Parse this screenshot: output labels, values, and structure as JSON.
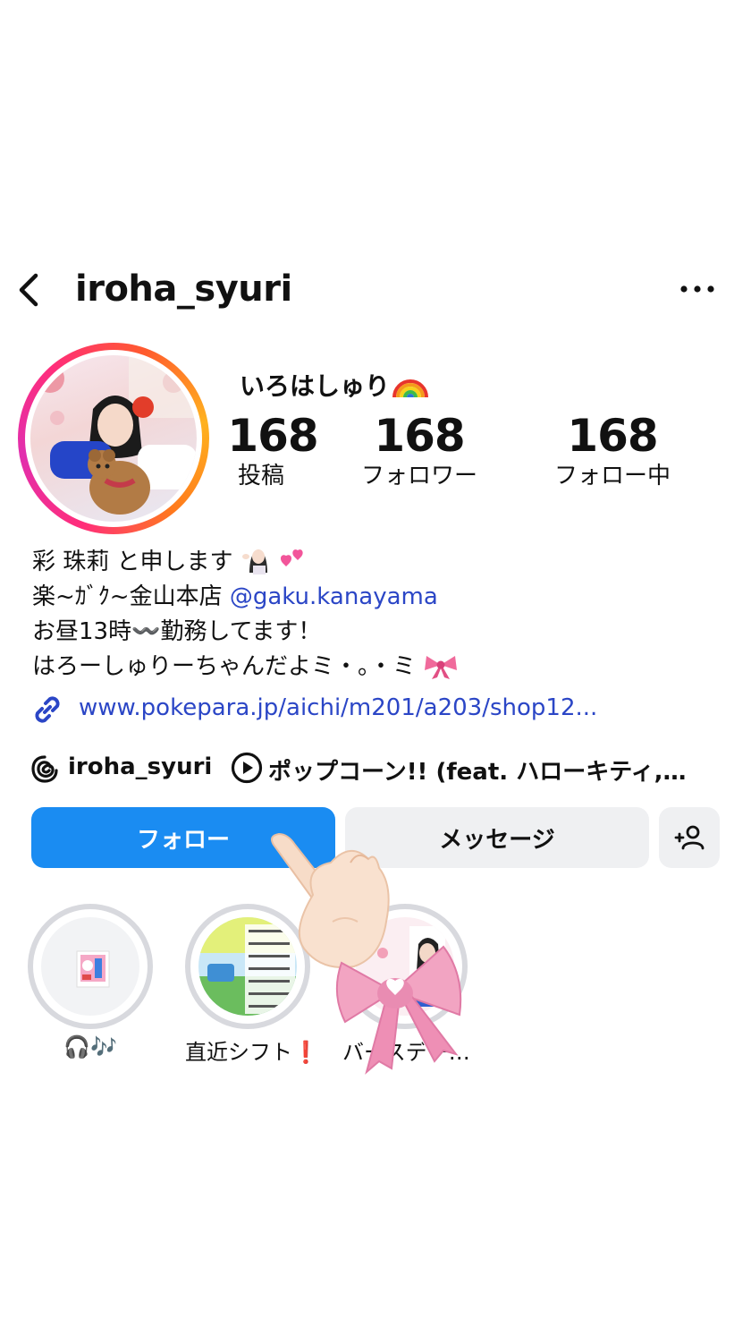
{
  "header": {
    "username": "iroha_syuri"
  },
  "profile": {
    "display_name": "いろはしゅり",
    "stats": [
      {
        "value": "168",
        "label": "投稿"
      },
      {
        "value": "168",
        "label": "フォロワー"
      },
      {
        "value": "168",
        "label": "フォロー中"
      }
    ],
    "bio": {
      "line1": "彩 珠莉 と申します",
      "line2_prefix": "楽~ｶﾞｸ~金山本店 ",
      "line2_mention": "@gaku.kanayama",
      "line3": "お昼13時〰️勤務してます！",
      "line4": "はろーしゅりーちゃんだよミ・。・ミ"
    },
    "link": "www.pokepara.jp/aichi/m201/a203/shop12...",
    "threads_username": "iroha_syuri",
    "music": "ポップコーン!! (feat. ハローキティ,…"
  },
  "buttons": {
    "follow": "フォロー",
    "message": "メッセージ"
  },
  "highlights": [
    {
      "label": "🎧🎶"
    },
    {
      "label": "直近シフト❗"
    },
    {
      "label": "バースデー…"
    }
  ],
  "colors": {
    "follow_button": "#1a8cf2",
    "secondary_button": "#eff0f2",
    "link": "#2b46c6"
  }
}
